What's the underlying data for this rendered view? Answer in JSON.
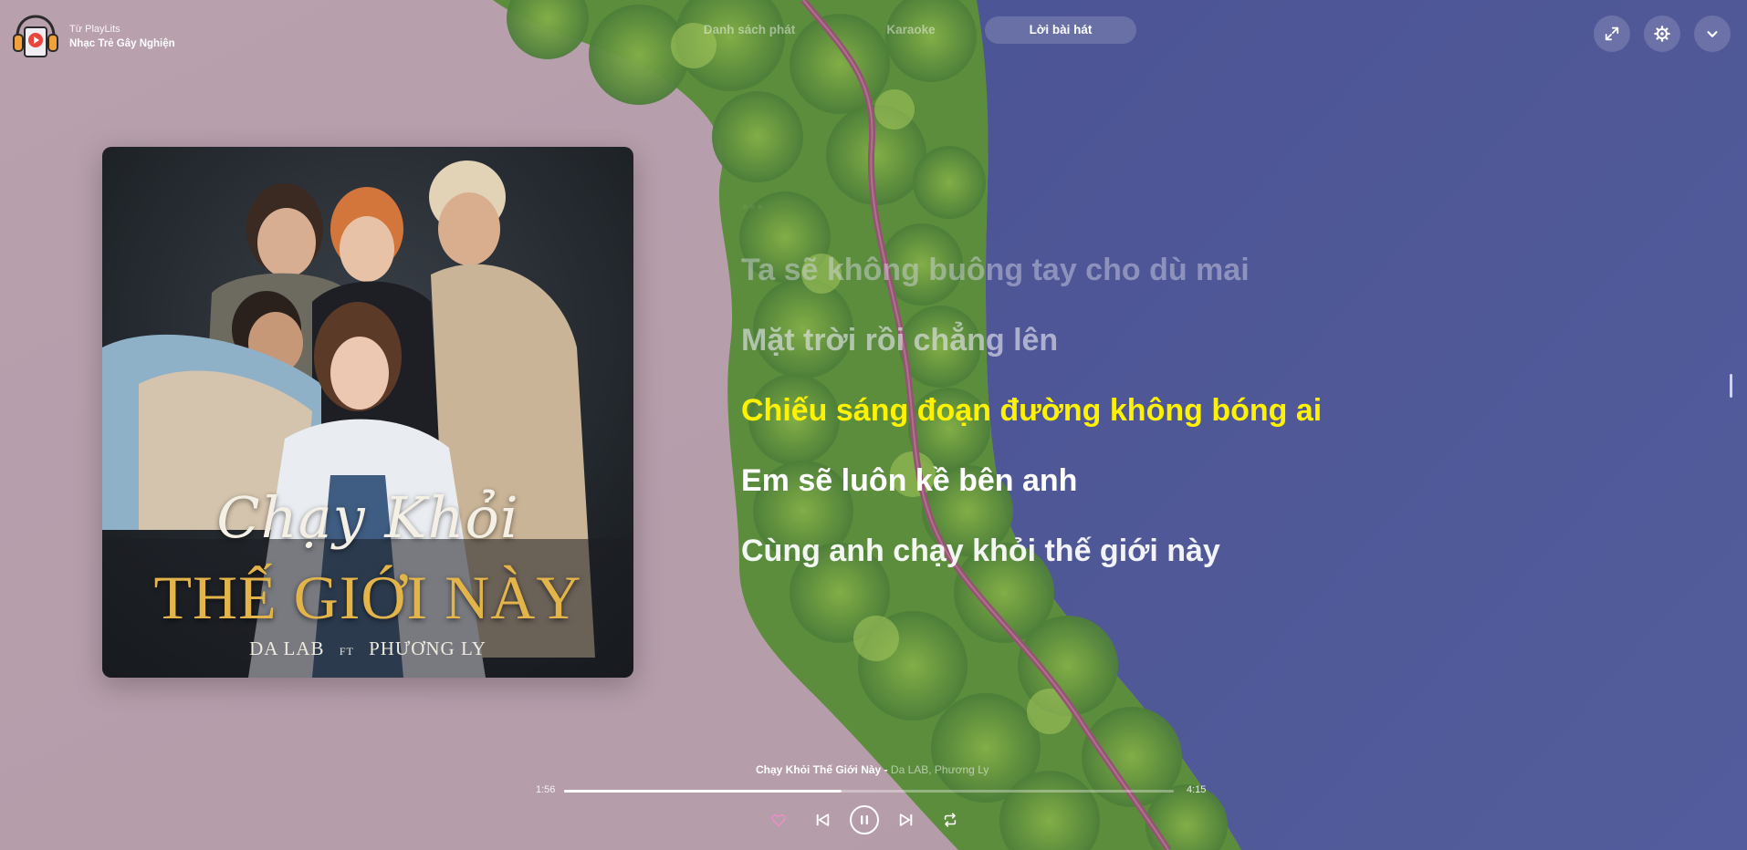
{
  "brand": {
    "from_label": "Từ PlayLits",
    "playlist_name": "Nhạc Trẻ Gây Nghiện",
    "icon": "headphones-play-icon"
  },
  "tabs": [
    {
      "label": "Danh sách phát",
      "active": false
    },
    {
      "label": "Karaoke",
      "active": false
    },
    {
      "label": "Lời bài hát",
      "active": true
    }
  ],
  "top_actions": [
    {
      "icon": "expand-icon"
    },
    {
      "icon": "gear-icon"
    },
    {
      "icon": "chevron-down-icon"
    }
  ],
  "cover": {
    "script_title": "Chạy Khỏi",
    "title": "THẾ GIỚI NÀY",
    "artist_left": "DA LAB",
    "ft": "FT",
    "artist_right": "PHƯƠNG LY"
  },
  "lyrics": {
    "faint_top": "...",
    "lines": [
      "Ta sẽ không buông tay cho dù mai",
      "Mặt trời rồi chẳng lên",
      "Chiếu sáng đoạn đường không bóng ai",
      "Em sẽ luôn kề bên anh",
      "Cùng anh chạy khỏi thế giới này"
    ],
    "active_index": 2
  },
  "player": {
    "song_title": "Chạy Khỏi Thế Giới Này",
    "separator": " - ",
    "artists": "Da LAB, Phương Ly",
    "elapsed": "1:56",
    "total": "4:15",
    "progress_fraction": 0.455
  },
  "colors": {
    "active_lyric": "#fff200",
    "heart": "#e88fc9",
    "water_blue": "#3f4c93",
    "water_pink": "#b9a1ad"
  }
}
